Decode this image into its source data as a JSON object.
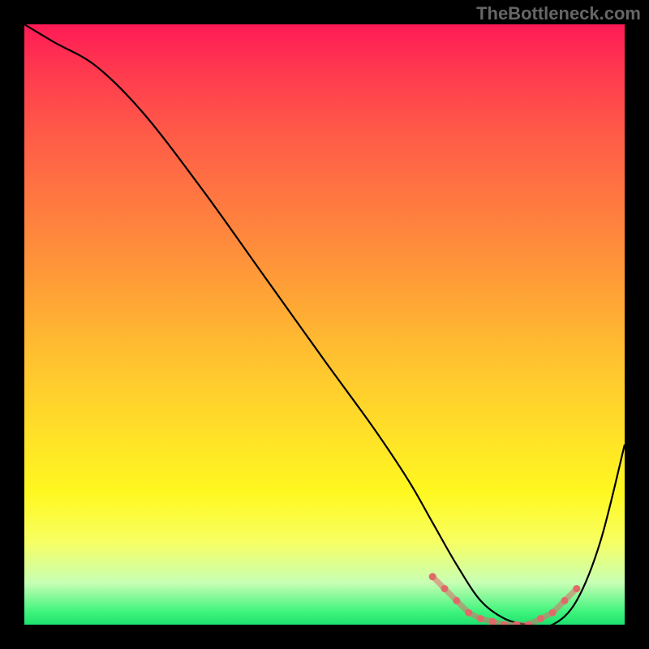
{
  "watermark": "TheBottleneck.com",
  "chart_data": {
    "type": "line",
    "title": "",
    "xlabel": "",
    "ylabel": "",
    "xlim": [
      0,
      100
    ],
    "ylim": [
      0,
      100
    ],
    "series": [
      {
        "name": "bottleneck-curve",
        "x": [
          0,
          5,
          12,
          20,
          30,
          40,
          50,
          58,
          64,
          68,
          72,
          76,
          80,
          84,
          88,
          92,
          96,
          100
        ],
        "y": [
          100,
          97,
          93,
          85,
          72,
          58,
          44,
          33,
          24,
          17,
          10,
          4,
          1,
          0,
          0,
          4,
          14,
          30
        ],
        "color": "#000000"
      }
    ],
    "flat_zone_markers": {
      "comment": "pink/red dotted segment along valley floor",
      "x": [
        68,
        70,
        72,
        74,
        76,
        78,
        80,
        82,
        84,
        86,
        88,
        90,
        92
      ],
      "y": [
        8,
        6,
        4,
        2,
        1,
        0.5,
        0,
        0,
        0,
        1,
        2,
        4,
        6
      ],
      "color": "#e06a6a"
    },
    "background": {
      "type": "vertical-gradient",
      "stops": [
        {
          "pos": 0.0,
          "color": "#ff1a55"
        },
        {
          "pos": 0.18,
          "color": "#ff5a48"
        },
        {
          "pos": 0.42,
          "color": "#ff9a38"
        },
        {
          "pos": 0.68,
          "color": "#ffe028"
        },
        {
          "pos": 0.86,
          "color": "#f8ff60"
        },
        {
          "pos": 0.98,
          "color": "#3cf37c"
        },
        {
          "pos": 1.0,
          "color": "#1de26e"
        }
      ]
    }
  }
}
